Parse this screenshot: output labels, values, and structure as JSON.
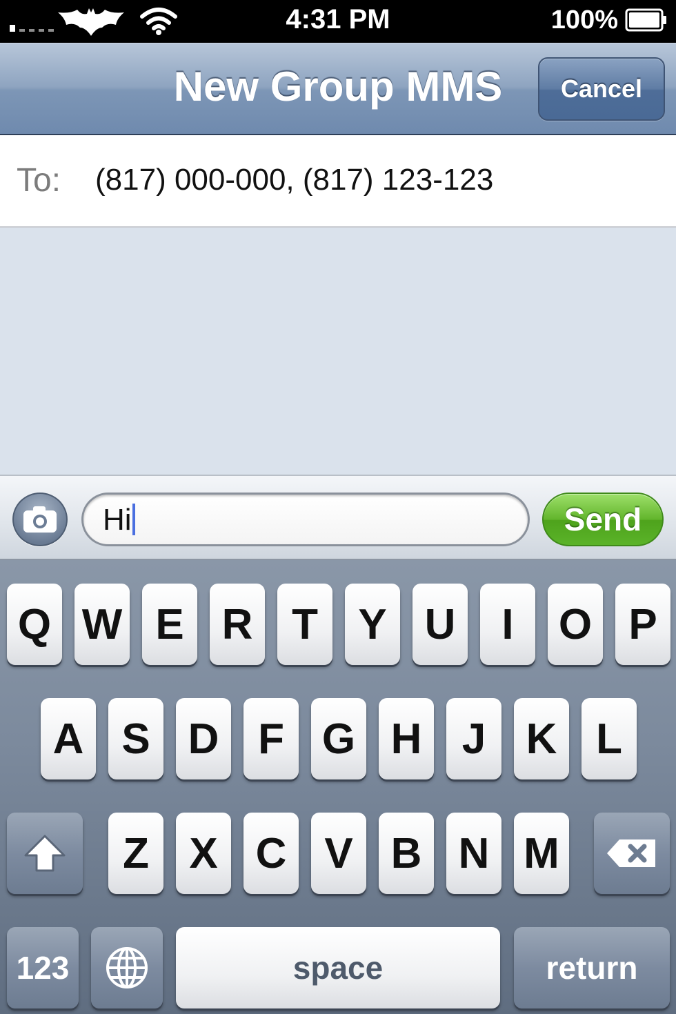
{
  "status_bar": {
    "time": "4:31 PM",
    "battery_percent": "100%",
    "icons": [
      "signal-icon",
      "carrier-logo-icon",
      "wifi-icon",
      "battery-icon"
    ]
  },
  "nav": {
    "title": "New Group MMS",
    "cancel_label": "Cancel"
  },
  "recipients": {
    "label": "To:",
    "value": "(817) 000-000, (817) 123-123"
  },
  "compose": {
    "text": "Hi",
    "send_label": "Send",
    "camera_icon": "camera-icon"
  },
  "keyboard": {
    "row1": [
      "Q",
      "W",
      "E",
      "R",
      "T",
      "Y",
      "U",
      "I",
      "O",
      "P"
    ],
    "row2": [
      "A",
      "S",
      "D",
      "F",
      "G",
      "H",
      "J",
      "K",
      "L"
    ],
    "row3": [
      "Z",
      "X",
      "C",
      "V",
      "B",
      "N",
      "M"
    ],
    "numbers_label": "123",
    "space_label": "space",
    "return_label": "return",
    "shift_icon": "shift-icon",
    "delete_icon": "delete-icon",
    "globe_icon": "globe-icon"
  },
  "colors": {
    "nav_blue": "#7d96b6",
    "send_green": "#5bb329",
    "message_bg": "#dae2ec",
    "caret": "#4a6fe0"
  }
}
